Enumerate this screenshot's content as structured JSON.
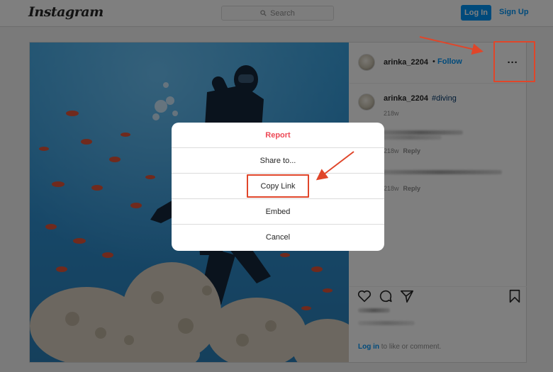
{
  "header": {
    "logo_text": "Instagram",
    "search_placeholder": "Search",
    "login_label": "Log In",
    "signup_label": "Sign Up"
  },
  "post": {
    "username": "arinka_2204",
    "separator": "•",
    "follow_label": "Follow",
    "more_label": "···",
    "caption_username": "arinka_2204",
    "caption_hashtag": "#diving",
    "caption_age": "218w",
    "comments": [
      {
        "age": "218w",
        "reply_label": "Reply"
      },
      {
        "age": "218w",
        "reply_label": "Reply"
      }
    ],
    "login_prompt_link": "Log in",
    "login_prompt_text": " to like or comment."
  },
  "modal": {
    "items": [
      {
        "label": "Report",
        "style": "danger"
      },
      {
        "label": "Share to..."
      },
      {
        "label": "Copy Link",
        "highlighted": true
      },
      {
        "label": "Embed"
      },
      {
        "label": "Cancel"
      }
    ]
  },
  "colors": {
    "accent_blue": "#0095f6",
    "danger_red": "#ed4956",
    "annotation_red": "#e0462a",
    "overlay": "rgba(0,0,0,0.5)"
  },
  "icons": [
    "search-icon",
    "heart-icon",
    "comment-icon",
    "share-icon",
    "bookmark-icon",
    "more-options-icon"
  ]
}
